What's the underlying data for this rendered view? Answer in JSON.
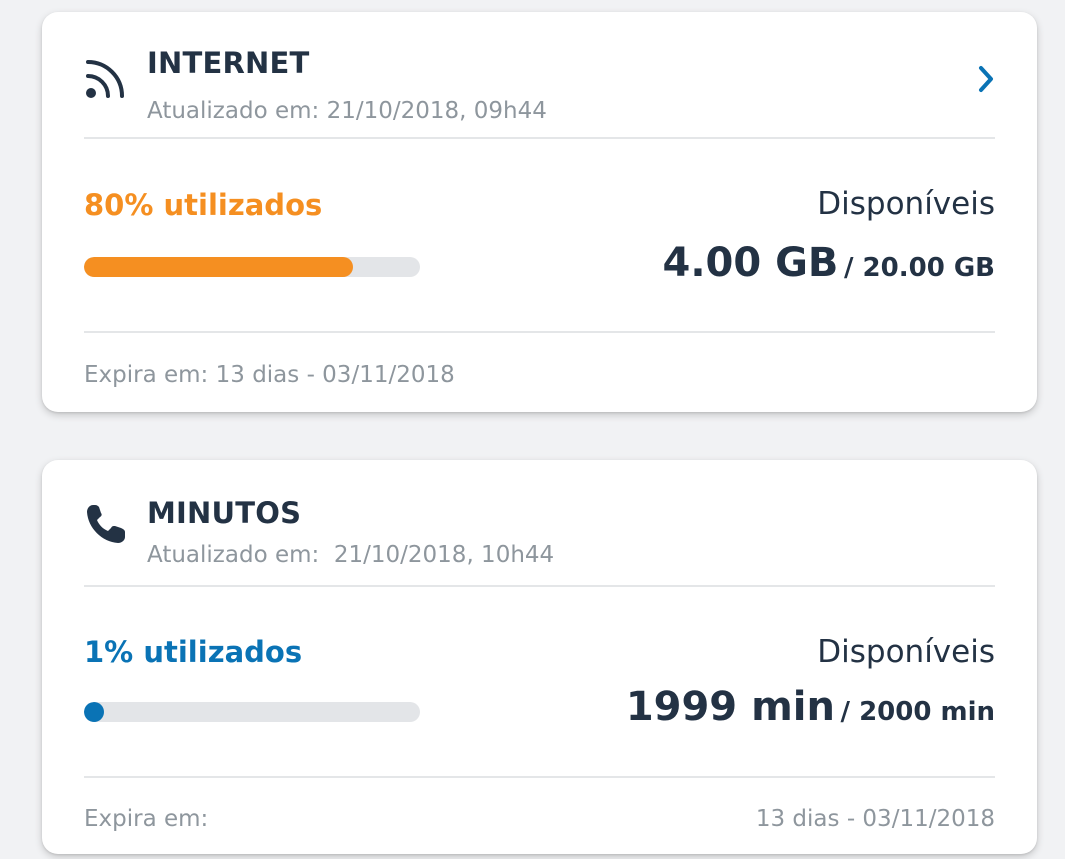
{
  "colors": {
    "orange": "#f58f21",
    "blue": "#0a73b5",
    "track": "#e3e5e8",
    "title": "#233244",
    "muted": "#8e969d"
  },
  "internet": {
    "icon": "rss-icon",
    "title": "INTERNET",
    "updated": "Atualizado em: 21/10/2018, 09h44",
    "used_percent": "80%",
    "used_label": "utilizados",
    "used_fraction": 0.8,
    "available_label": "Disponíveis",
    "available_value": "4.00 GB",
    "total_value": "/ 20.00 GB",
    "expires": "Expira em: 13 dias - 03/11/2018"
  },
  "minutos": {
    "icon": "phone-icon",
    "title": "MINUTOS",
    "updated": "Atualizado em:  21/10/2018, 10h44",
    "used_percent": "1%",
    "used_label": "utilizados",
    "used_fraction": 0.01,
    "available_label": "Disponíveis",
    "available_value": "1999 min",
    "total_value": "/ 2000 min",
    "expires_label": "Expira em:",
    "expires_value": "13 dias - 03/11/2018"
  }
}
